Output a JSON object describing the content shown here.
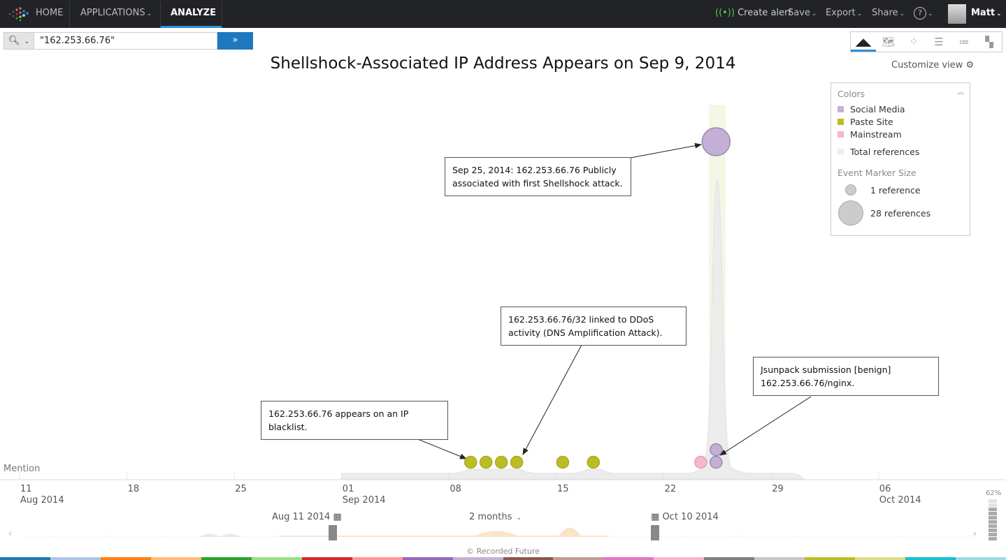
{
  "nav": {
    "home": "HOME",
    "applications": "APPLICATIONS",
    "analyze": "ANALYZE",
    "create_alert": "Create alert",
    "save": "Save",
    "export": "Export",
    "share": "Share",
    "help": "?",
    "user": "Matt"
  },
  "search": {
    "value": "\"162.253.66.76\"",
    "go_label": "»"
  },
  "view_icons": [
    "timeline-icon",
    "map-icon",
    "network-icon",
    "table-icon",
    "list-icon",
    "dashboard-icon"
  ],
  "title": "Shellshock-Associated IP Address Appears on Sep 9, 2014",
  "customize_view": "Customize view",
  "legend": {
    "colors_heading": "Colors",
    "items": [
      {
        "label": "Social Media",
        "color": "#c5b0d5"
      },
      {
        "label": "Paste Site",
        "color": "#bcbd22"
      },
      {
        "label": "Mainstream",
        "color": "#f7b6d2"
      },
      {
        "label": "Total references",
        "color": "#eeeeee"
      }
    ],
    "size_heading": "Event Marker Size",
    "sizes": [
      {
        "label": "1 reference"
      },
      {
        "label": "28 references"
      }
    ]
  },
  "callouts": [
    {
      "text": "Sep 25, 2014: 162.253.66.76 Publicly associated with first Shellshock attack."
    },
    {
      "text": "162.253.66.76/32 linked to DDoS activity (DNS Amplification Attack)."
    },
    {
      "text": "162.253.66.76 appears on an IP blacklist."
    },
    {
      "text": "Jsunpack submission [benign] 162.253.66.76/nginx."
    }
  ],
  "chart_data": {
    "type": "scatter",
    "ylabel": "Mention",
    "events": [
      {
        "date": "2014-09-09",
        "source": "Paste Site",
        "references": 1
      },
      {
        "date": "2014-09-10",
        "source": "Paste Site",
        "references": 1
      },
      {
        "date": "2014-09-11",
        "source": "Paste Site",
        "references": 1
      },
      {
        "date": "2014-09-12",
        "source": "Paste Site",
        "references": 1
      },
      {
        "date": "2014-09-15",
        "source": "Paste Site",
        "references": 1
      },
      {
        "date": "2014-09-17",
        "source": "Paste Site",
        "references": 1
      },
      {
        "date": "2014-09-24",
        "source": "Mainstream",
        "references": 1
      },
      {
        "date": "2014-09-25",
        "source": "Social Media",
        "references": 1
      },
      {
        "date": "2014-09-25",
        "source": "Social Media",
        "references": 1
      },
      {
        "date": "2014-09-25",
        "source": "Social Media",
        "references": 28
      }
    ]
  },
  "axis": {
    "ticks": [
      {
        "day": "11",
        "month": "Aug 2014"
      },
      {
        "day": "18",
        "month": ""
      },
      {
        "day": "25",
        "month": ""
      },
      {
        "day": "01",
        "month": "Sep 2014"
      },
      {
        "day": "08",
        "month": ""
      },
      {
        "day": "15",
        "month": ""
      },
      {
        "day": "22",
        "month": ""
      },
      {
        "day": "29",
        "month": ""
      },
      {
        "day": "06",
        "month": "Oct 2014"
      }
    ]
  },
  "brush": {
    "start": "Aug 11 2014",
    "end": "Oct 10 2014",
    "range": "2 months"
  },
  "zoom_level": "62%",
  "footer": "© Recorded Future",
  "colors": {
    "nav_bg": "#222326",
    "accent": "#1f78bf",
    "paste": "#bcbd22",
    "social": "#c5b0d5",
    "mainstream": "#f7b6d2"
  },
  "palette": [
    "#1f77b4",
    "#aec7e8",
    "#ff7f0e",
    "#ffbb78",
    "#2ca02c",
    "#98df8a",
    "#d62728",
    "#ff9896",
    "#9467bd",
    "#c5b0d5",
    "#8c564b",
    "#c49c94",
    "#e377c2",
    "#f7b6d2",
    "#7f7f7f",
    "#c7c7c7",
    "#bcbd22",
    "#dbdb8d",
    "#17becf",
    "#9edae5"
  ]
}
